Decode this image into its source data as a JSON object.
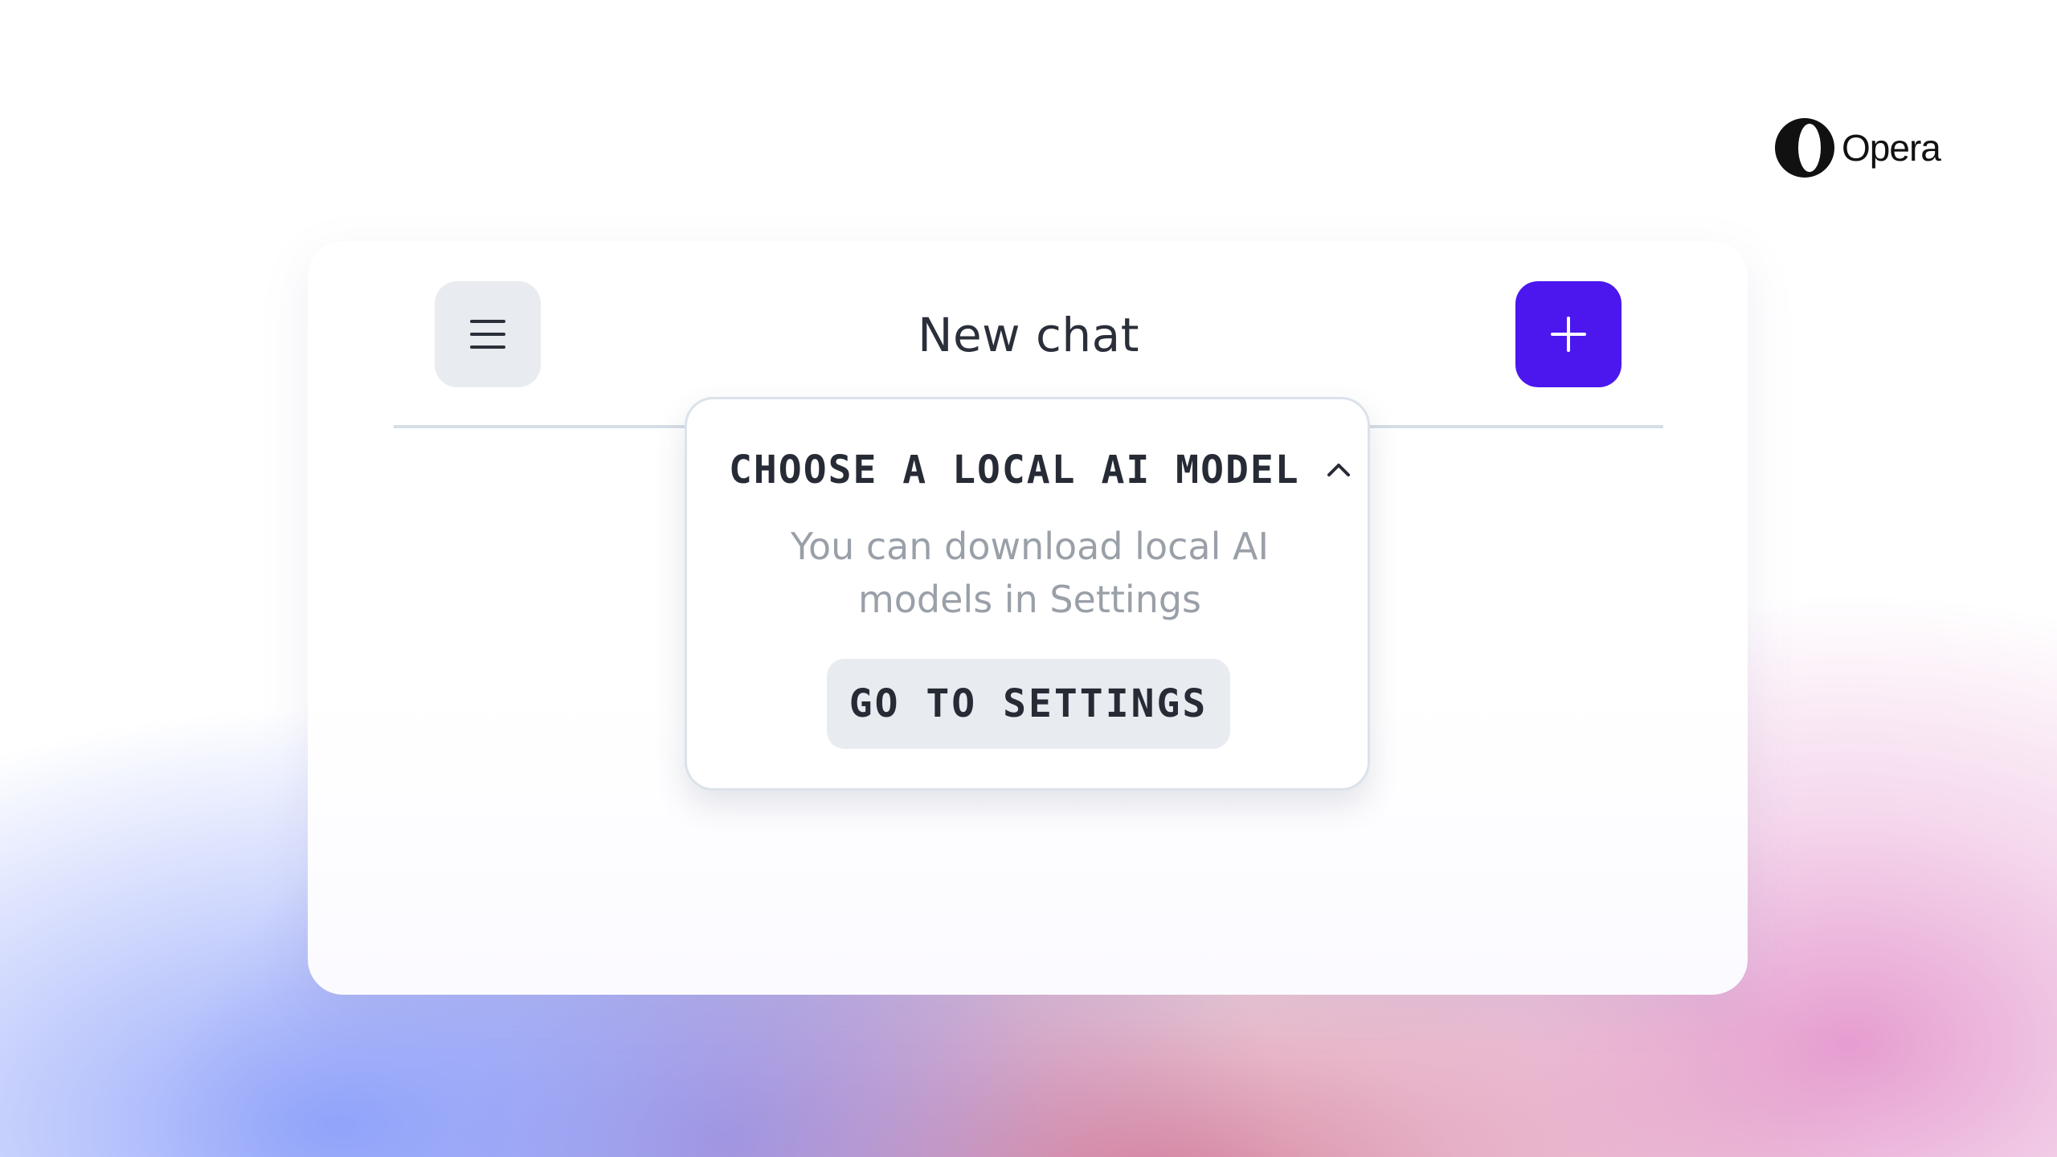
{
  "brand": {
    "name": "Opera",
    "logo_icon": "opera-logo"
  },
  "header": {
    "title": "New chat",
    "menu_icon": "hamburger-menu-icon",
    "new_chat_icon": "plus-icon",
    "new_chat_color": "#4b17ee"
  },
  "model_picker": {
    "heading": "CHOOSE A LOCAL AI MODEL",
    "chevron_icon": "chevron-up-icon",
    "description": "You can download local AI models in Settings",
    "button_label": "GO TO SETTINGS"
  }
}
